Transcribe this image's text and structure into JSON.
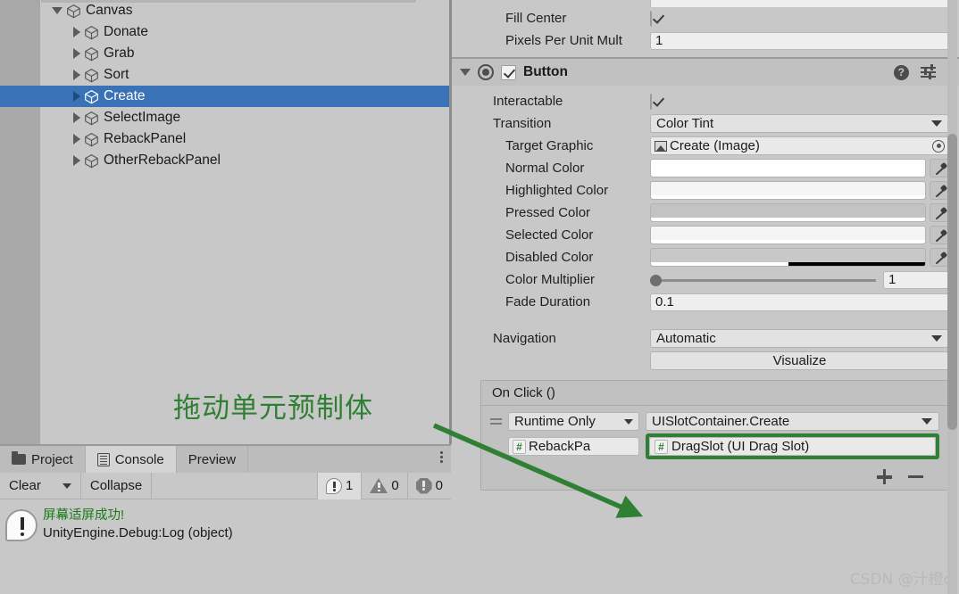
{
  "hierarchy": {
    "items": [
      {
        "label": "Canvas",
        "depth": 0,
        "expanded": true,
        "selected": false,
        "icon": "prefab-cube-icon"
      },
      {
        "label": "Donate",
        "depth": 1,
        "expanded": false,
        "selected": false,
        "icon": "prefab-cube-icon"
      },
      {
        "label": "Grab",
        "depth": 1,
        "expanded": false,
        "selected": false,
        "icon": "prefab-cube-icon"
      },
      {
        "label": "Sort",
        "depth": 1,
        "expanded": false,
        "selected": false,
        "icon": "prefab-cube-icon"
      },
      {
        "label": "Create",
        "depth": 1,
        "expanded": false,
        "selected": true,
        "icon": "prefab-cube-icon"
      },
      {
        "label": "SelectImage",
        "depth": 1,
        "expanded": false,
        "selected": false,
        "icon": "prefab-cube-icon"
      },
      {
        "label": "RebackPanel",
        "depth": 1,
        "expanded": false,
        "selected": false,
        "icon": "prefab-cube-icon"
      },
      {
        "label": "OtherRebackPanel",
        "depth": 1,
        "expanded": false,
        "selected": false,
        "icon": "prefab-cube-icon"
      }
    ],
    "selection_color": "#3a72b8"
  },
  "annotation": {
    "text": "拖动单元预制体",
    "color": "#2f8034"
  },
  "console": {
    "tabs": [
      {
        "label": "Project",
        "active": false,
        "icon": "folder-icon"
      },
      {
        "label": "Console",
        "active": true,
        "icon": "console-icon"
      },
      {
        "label": "Preview",
        "active": false,
        "icon": "none"
      }
    ],
    "toolbar": {
      "clear_label": "Clear",
      "collapse_label": "Collapse"
    },
    "counts": {
      "log": "1",
      "warning": "0",
      "error": "0"
    },
    "entry": {
      "message": "屏幕适屏成功!",
      "stack": "UnityEngine.Debug:Log (object)",
      "message_color": "#1a7a1a"
    }
  },
  "inspector": {
    "top_rows": [
      {
        "label": "Fill Center",
        "type": "checkbox",
        "value": true,
        "indent": 1
      },
      {
        "label": "Pixels Per Unit Mult",
        "type": "text",
        "value": "1",
        "indent": 1
      }
    ],
    "component": {
      "title": "Button",
      "enabled": true,
      "expanded": true,
      "help_label": "?",
      "rows": [
        {
          "label": "Interactable",
          "type": "checkbox",
          "value": true,
          "indent": 0
        },
        {
          "label": "Transition",
          "type": "dropdown",
          "value": "Color Tint",
          "indent": 0
        },
        {
          "label": "Target Graphic",
          "type": "object",
          "value": "Create (Image)",
          "indent": 1,
          "icon": "image-icon"
        },
        {
          "label": "Normal Color",
          "type": "color",
          "value": "#ffffff",
          "alpha": 100,
          "indent": 1
        },
        {
          "label": "Highlighted Color",
          "type": "color",
          "value": "#f5f5f5",
          "alpha": 100,
          "indent": 1
        },
        {
          "label": "Pressed Color",
          "type": "color",
          "value": "#c3c3c3",
          "alpha": 100,
          "indent": 1
        },
        {
          "label": "Selected Color",
          "type": "color",
          "value": "#f5f5f5",
          "alpha": 100,
          "indent": 1
        },
        {
          "label": "Disabled Color",
          "type": "color",
          "value": "#c8c8c8",
          "alpha": 50,
          "indent": 1
        },
        {
          "label": "Color Multiplier",
          "type": "slider",
          "value": "1",
          "slider_pct": 0,
          "indent": 1
        },
        {
          "label": "Fade Duration",
          "type": "text",
          "value": "0.1",
          "indent": 1
        },
        {
          "label": "Navigation",
          "type": "dropdown",
          "value": "Automatic",
          "indent": 0
        }
      ],
      "visualize_label": "Visualize"
    },
    "on_click": {
      "title": "On Click ()",
      "event": {
        "runtime_mode": "Runtime Only",
        "method": "UISlotContainer.Create",
        "target_object_left": "RebackPa",
        "target_object_right": "DragSlot (UI Drag Slot)",
        "highlight_color": "#2f8034"
      },
      "add_label": "+",
      "remove_label": "-"
    }
  },
  "watermark": "CSDN @汁橙c"
}
